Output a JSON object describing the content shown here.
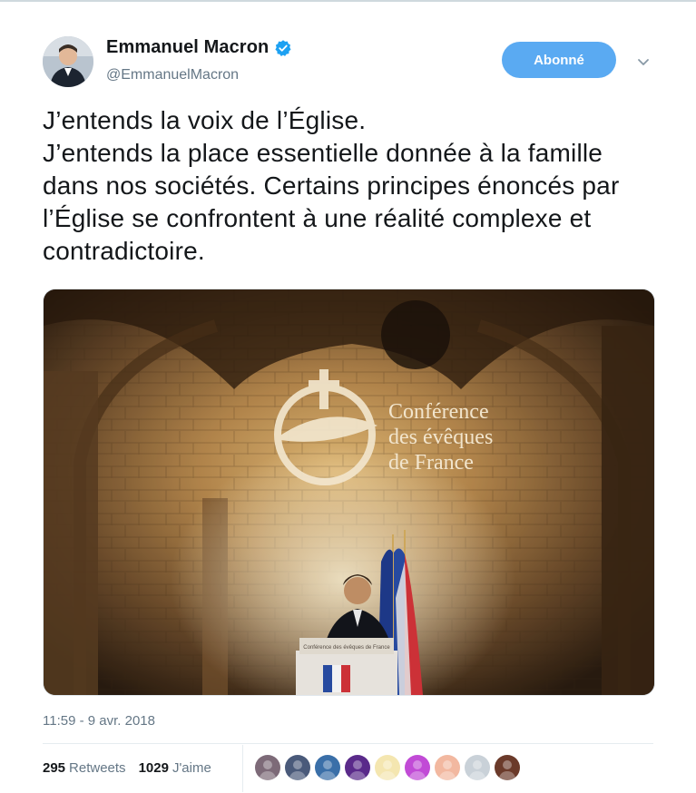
{
  "tweet": {
    "author_name": "Emmanuel Macron",
    "author_handle": "@EmmanuelMacron",
    "follow_label": "Abonné",
    "text": "J’entends la voix de l’Église.\nJ’entends la place essentielle donnée à la famille dans nos sociétés. Certains principes énoncés par l’Église se confrontent à une réalité complexe et contradictoire.",
    "timestamp": "11:59 - 9 avr. 2018",
    "retweets_count": "295",
    "retweets_label": "Retweets",
    "likes_count": "1029",
    "likes_label": "J'aime",
    "media": {
      "logo_line1": "Conférence",
      "logo_line2": "des évêques",
      "logo_line3": "de France",
      "podium_sign": "Conférence des évêques de France"
    }
  },
  "colors": {
    "follow_button": "#5aaaf2",
    "verified_badge": "#1da1f2",
    "secondary_text": "#657786"
  },
  "icons": [
    "verified-badge-icon",
    "chevron-down-icon"
  ],
  "liker_avatars": [
    {
      "bg": "#7d6a78"
    },
    {
      "bg": "#4a5a7a"
    },
    {
      "bg": "#3a6fa8"
    },
    {
      "bg": "#5a2a8a"
    },
    {
      "bg": "#f4e6b0"
    },
    {
      "bg": "#c14bd6"
    },
    {
      "bg": "#f2b8a0"
    },
    {
      "bg": "#c9d1d8"
    },
    {
      "bg": "#6b3a2a"
    }
  ]
}
